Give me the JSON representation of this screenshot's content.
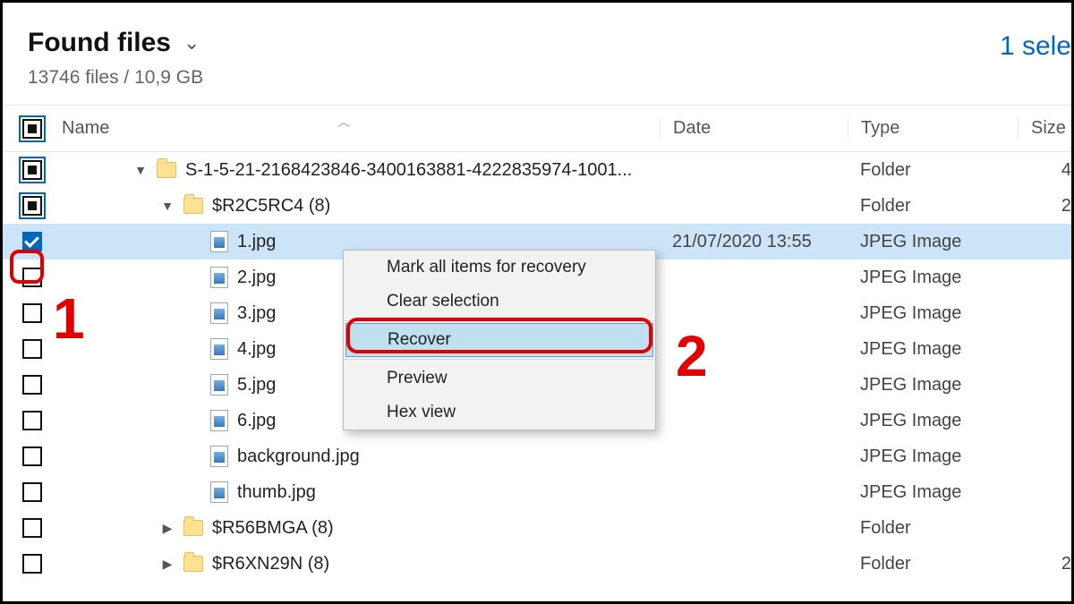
{
  "header": {
    "title": "Found files",
    "subtitle": "13746 files / 10,9 GB",
    "selection": "1 sele"
  },
  "columns": {
    "name": "Name",
    "date": "Date",
    "type": "Type",
    "size": "Size"
  },
  "types": {
    "folder": "Folder",
    "jpeg": "JPEG Image"
  },
  "rows": [
    {
      "name": "S-1-5-21-2168423846-3400163881-4222835974-1001...",
      "type_key": "folder",
      "date": "",
      "size": "4",
      "indent": "indent1",
      "check": "partial",
      "tri": "▼",
      "icon": "folder"
    },
    {
      "name": "$R2C5RC4 (8)",
      "type_key": "folder",
      "date": "",
      "size": "2",
      "indent": "indent2",
      "check": "partial",
      "tri": "▼",
      "icon": "folder"
    },
    {
      "name": "1.jpg",
      "type_key": "jpeg",
      "date": "21/07/2020 13:55",
      "size": "",
      "indent": "indent3",
      "check": "checked",
      "tri": "",
      "icon": "file",
      "selected": true
    },
    {
      "name": "2.jpg",
      "type_key": "jpeg",
      "date": "",
      "size": "",
      "indent": "indent3",
      "check": "",
      "tri": "",
      "icon": "file"
    },
    {
      "name": "3.jpg",
      "type_key": "jpeg",
      "date": "",
      "size": "",
      "indent": "indent3",
      "check": "",
      "tri": "",
      "icon": "file"
    },
    {
      "name": "4.jpg",
      "type_key": "jpeg",
      "date": "",
      "size": "",
      "indent": "indent3",
      "check": "",
      "tri": "",
      "icon": "file"
    },
    {
      "name": "5.jpg",
      "type_key": "jpeg",
      "date": "",
      "size": "",
      "indent": "indent3",
      "check": "",
      "tri": "",
      "icon": "file"
    },
    {
      "name": "6.jpg",
      "type_key": "jpeg",
      "date": "",
      "size": "",
      "indent": "indent3",
      "check": "",
      "tri": "",
      "icon": "file"
    },
    {
      "name": "background.jpg",
      "type_key": "jpeg",
      "date": "",
      "size": "",
      "indent": "indent3",
      "check": "",
      "tri": "",
      "icon": "file"
    },
    {
      "name": "thumb.jpg",
      "type_key": "jpeg",
      "date": "",
      "size": "",
      "indent": "indent3",
      "check": "",
      "tri": "",
      "icon": "file"
    },
    {
      "name": "$R56BMGA (8)",
      "type_key": "folder",
      "date": "",
      "size": "",
      "indent": "indent2",
      "check": "",
      "tri": "▶",
      "icon": "folder"
    },
    {
      "name": "$R6XN29N (8)",
      "type_key": "folder",
      "date": "",
      "size": "2",
      "indent": "indent2",
      "check": "",
      "tri": "▶",
      "icon": "folder"
    }
  ],
  "context_menu": {
    "items": [
      {
        "label": "Mark all items for recovery"
      },
      {
        "label": "Clear selection"
      },
      {
        "label": "Recover",
        "hover": true
      },
      {
        "label": "Preview"
      },
      {
        "label": "Hex view"
      }
    ]
  },
  "annotations": {
    "one": "1",
    "two": "2"
  }
}
